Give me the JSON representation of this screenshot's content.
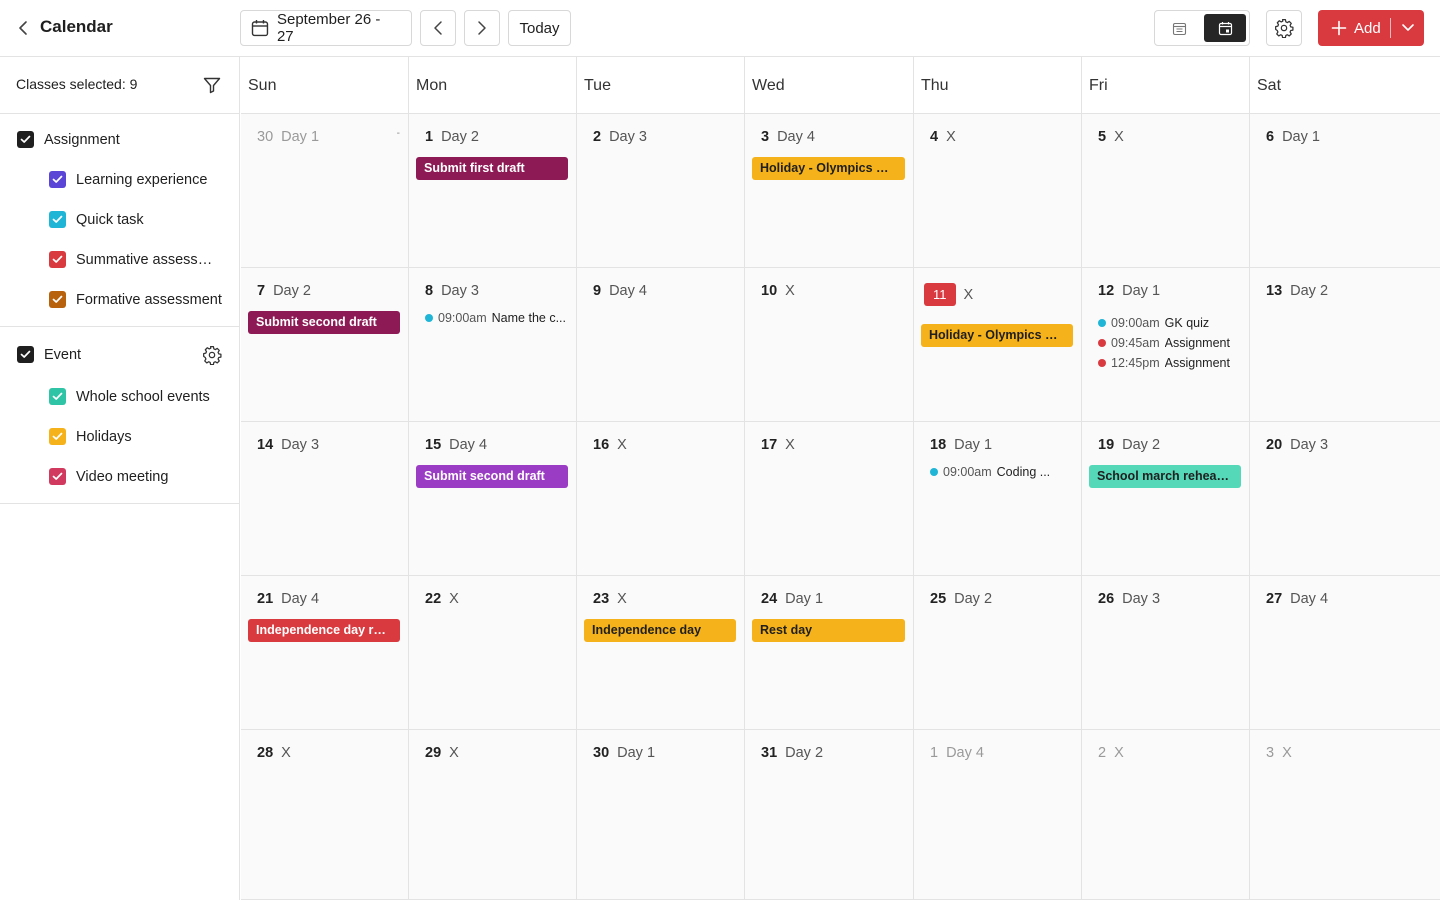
{
  "header": {
    "title": "Calendar",
    "date_range": "September 26 - 27",
    "today_label": "Today",
    "add_label": "Add"
  },
  "colors": {
    "brand": "#d93a3f",
    "learning": "#5b45d6",
    "quick": "#1fb5d6",
    "summative": "#d93a3f",
    "formative": "#b8620e",
    "whole_school": "#2fc4a6",
    "holidays": "#f5b21a",
    "video": "#d13a5e"
  },
  "sidebar": {
    "classes_selected": "Classes selected: 9",
    "assignment": {
      "label": "Assignment",
      "items": [
        {
          "label": "Learning experience",
          "color": "#5b45d6"
        },
        {
          "label": "Quick task",
          "color": "#1fb5d6"
        },
        {
          "label": "Summative assessment",
          "color": "#d93a3f"
        },
        {
          "label": "Formative assessment",
          "color": "#b8620e"
        }
      ]
    },
    "event": {
      "label": "Event",
      "items": [
        {
          "label": "Whole school events",
          "color": "#2fc4a6"
        },
        {
          "label": "Holidays",
          "color": "#f5b21a"
        },
        {
          "label": "Video meeting",
          "color": "#d13a5e"
        }
      ]
    }
  },
  "calendar": {
    "weekdays": [
      "Sun",
      "Mon",
      "Tue",
      "Wed",
      "Thu",
      "Fri",
      "Sat"
    ],
    "weeks": [
      [
        {
          "num": "30",
          "day": "Day 1",
          "other": true,
          "dash": "-"
        },
        {
          "num": "1",
          "day": "Day 2",
          "events": [
            {
              "title": "Submit first draft",
              "bg": "#8e1a55",
              "fg": "#ffffff"
            }
          ]
        },
        {
          "num": "2",
          "day": "Day 3"
        },
        {
          "num": "3",
          "day": "Day 4",
          "events": [
            {
              "title": "Holiday - Olympics Day",
              "bg": "#f5b21a",
              "fg": "#1f1f1f"
            }
          ]
        },
        {
          "num": "4",
          "day": "X"
        },
        {
          "num": "5",
          "day": "X"
        },
        {
          "num": "6",
          "day": "Day 1"
        }
      ],
      [
        {
          "num": "7",
          "day": "Day 2",
          "events": [
            {
              "title": "Submit second draft",
              "bg": "#8e1a55",
              "fg": "#ffffff"
            }
          ]
        },
        {
          "num": "8",
          "day": "Day 3",
          "items": [
            {
              "time": "09:00am",
              "title": "Name the c...",
              "dot": "#1fb5d6"
            }
          ]
        },
        {
          "num": "9",
          "day": "Day 4"
        },
        {
          "num": "10",
          "day": "X"
        },
        {
          "num": "11",
          "day": "X",
          "today": true,
          "events": [
            {
              "title": "Holiday - Olympics Day",
              "bg": "#f5b21a",
              "fg": "#1f1f1f"
            }
          ]
        },
        {
          "num": "12",
          "day": "Day 1",
          "items": [
            {
              "time": "09:00am",
              "title": "GK quiz",
              "dot": "#1fb5d6"
            },
            {
              "time": "09:45am",
              "title": "Assignment",
              "dot": "#d93a3f"
            },
            {
              "time": "12:45pm",
              "title": "Assignment",
              "dot": "#d93a3f"
            }
          ]
        },
        {
          "num": "13",
          "day": "Day 2"
        }
      ],
      [
        {
          "num": "14",
          "day": "Day 3"
        },
        {
          "num": "15",
          "day": "Day 4",
          "events": [
            {
              "title": "Submit second draft",
              "bg": "#9b3cc4",
              "fg": "#ffffff"
            }
          ]
        },
        {
          "num": "16",
          "day": "X"
        },
        {
          "num": "17",
          "day": "X"
        },
        {
          "num": "18",
          "day": "Day 1",
          "items": [
            {
              "time": "09:00am",
              "title": "Coding ...",
              "dot": "#1fb5d6"
            }
          ]
        },
        {
          "num": "19",
          "day": "Day 2",
          "events": [
            {
              "title": "School march rehearsal",
              "bg": "#54d8b8",
              "fg": "#1f1f1f"
            }
          ]
        },
        {
          "num": "20",
          "day": "Day 3"
        }
      ],
      [
        {
          "num": "21",
          "day": "Day 4",
          "events": [
            {
              "title": "Independence day rhe..",
              "bg": "#d93a3f",
              "fg": "#ffffff"
            }
          ]
        },
        {
          "num": "22",
          "day": "X"
        },
        {
          "num": "23",
          "day": "X",
          "events": [
            {
              "title": "Independence day",
              "bg": "#f5b21a",
              "fg": "#1f1f1f"
            }
          ]
        },
        {
          "num": "24",
          "day": "Day 1",
          "events": [
            {
              "title": "Rest day",
              "bg": "#f5b21a",
              "fg": "#1f1f1f"
            }
          ]
        },
        {
          "num": "25",
          "day": "Day 2"
        },
        {
          "num": "26",
          "day": "Day 3"
        },
        {
          "num": "27",
          "day": "Day 4"
        }
      ],
      [
        {
          "num": "28",
          "day": "X"
        },
        {
          "num": "29",
          "day": "X"
        },
        {
          "num": "30",
          "day": "Day  1"
        },
        {
          "num": "31",
          "day": "Day 2"
        },
        {
          "num": "1",
          "day": "Day 4",
          "other": true
        },
        {
          "num": "2",
          "day": "X",
          "other": true
        },
        {
          "num": "3",
          "day": "X",
          "other": true
        }
      ]
    ]
  }
}
